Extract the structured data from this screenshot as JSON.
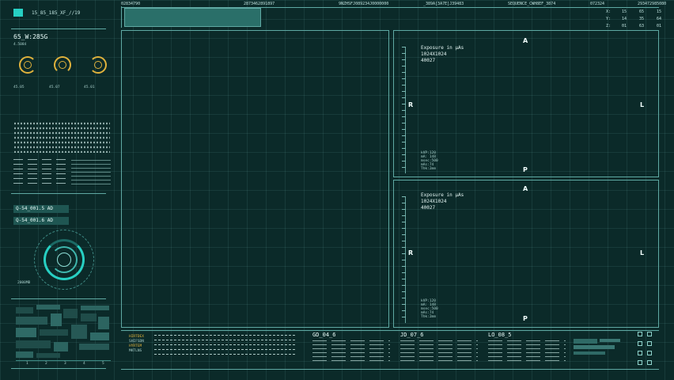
{
  "top": {
    "id_label": "15_85_185_XF_//19",
    "codes": [
      "02834790",
      "2873462891897",
      "9NZHSFJ089234J0000000",
      "_389A[3A7E]J39483",
      "SEQUENCE_CWH8EF_3874",
      "072324",
      "293472985080"
    ],
    "accent": "#27d0c3"
  },
  "coords": [
    {
      "axis": "X:",
      "a": "15",
      "b": "65",
      "c": "15"
    },
    {
      "axis": "Y:",
      "a": "14",
      "b": "35",
      "c": "64"
    },
    {
      "axis": "Z:",
      "a": "01",
      "b": "63",
      "c": "01"
    }
  ],
  "left": {
    "title": "65_W:285G",
    "subtitle": "4.5084",
    "dials": [
      "45.05",
      "45.07",
      "45.01"
    ],
    "buttons": [
      "Q-54_001.5 AD",
      "Q-54_001.6 AD"
    ],
    "radar_label": "2000MB",
    "bottom_axis": [
      "1",
      "2",
      "3",
      "4",
      "5"
    ]
  },
  "panels": [
    {
      "top": "A",
      "left": "R",
      "right": "L",
      "bottom": "P",
      "caption": "Exposure in µAs",
      "size": "1024X1024",
      "value": "40027",
      "params": [
        "kVP:120",
        "mA: 148",
        "msec:500",
        "mAs:74",
        "Thk:2mm"
      ]
    },
    {
      "top": "A",
      "left": "R",
      "right": "L",
      "bottom": "P",
      "caption": "Exposure in µAs",
      "size": "1024X1024",
      "value": "40027",
      "params": [
        "kVP:120",
        "mA: 148",
        "msec:500",
        "mAs:74",
        "Thk:2mm"
      ]
    }
  ],
  "bottom": {
    "sections": [
      "GD_04_6",
      "JD_07_6",
      "LO_08_5"
    ],
    "left_labels": [
      "HIRTDEX",
      "SHIFSDN",
      "HYRTEM",
      "MKTLNS"
    ]
  },
  "colors": {
    "bg": "#0b2a29",
    "line": "#5fa9a3",
    "gold": "#e0b23c",
    "cyan": "#27d0c3"
  }
}
